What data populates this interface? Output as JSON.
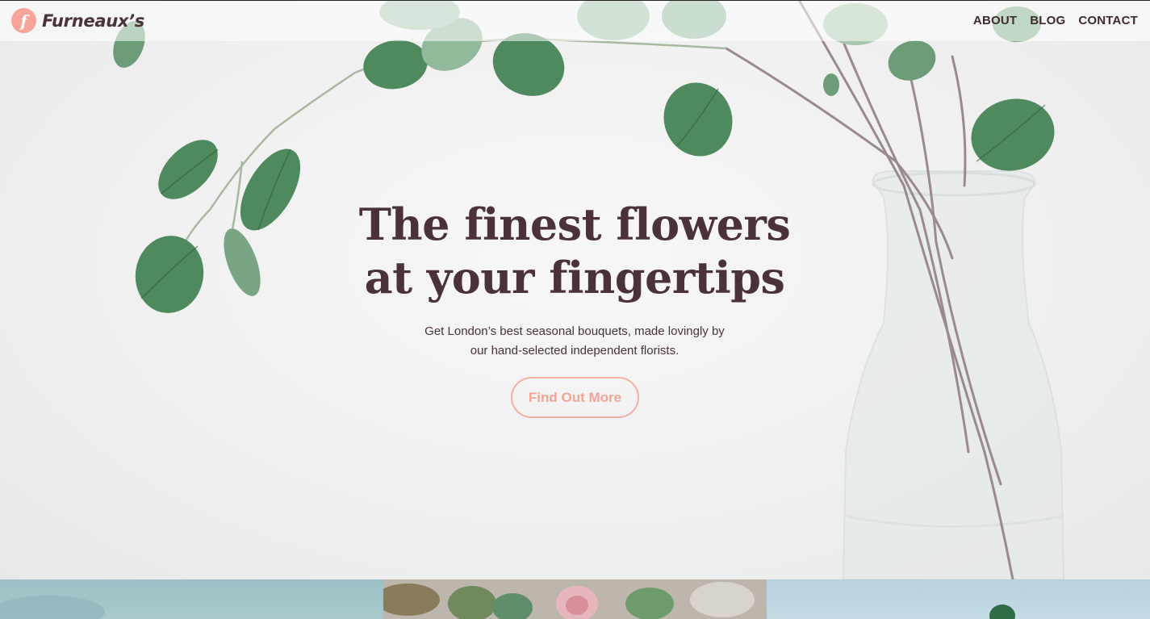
{
  "brand": {
    "logo_letter": "f",
    "name": "Furneaux’s",
    "accent_color": "#f7a49a",
    "text_color": "#4a3238"
  },
  "nav": {
    "items": [
      {
        "label": "ABOUT"
      },
      {
        "label": "BLOG"
      },
      {
        "label": "CONTACT"
      }
    ]
  },
  "hero": {
    "headline_line1": "The finest flowers",
    "headline_line2": "at your fingertips",
    "subtext_line1": "Get London’s best seasonal bouquets, made lovingly by",
    "subtext_line2": "our hand-selected independent florists.",
    "cta_label": "Find Out More",
    "background_image": "eucalyptus-branches-in-glass-vase"
  },
  "gallery": {
    "images": [
      "teal-flower-photo",
      "flower-bouquet-photo",
      "light-blue-plant-photo"
    ]
  }
}
